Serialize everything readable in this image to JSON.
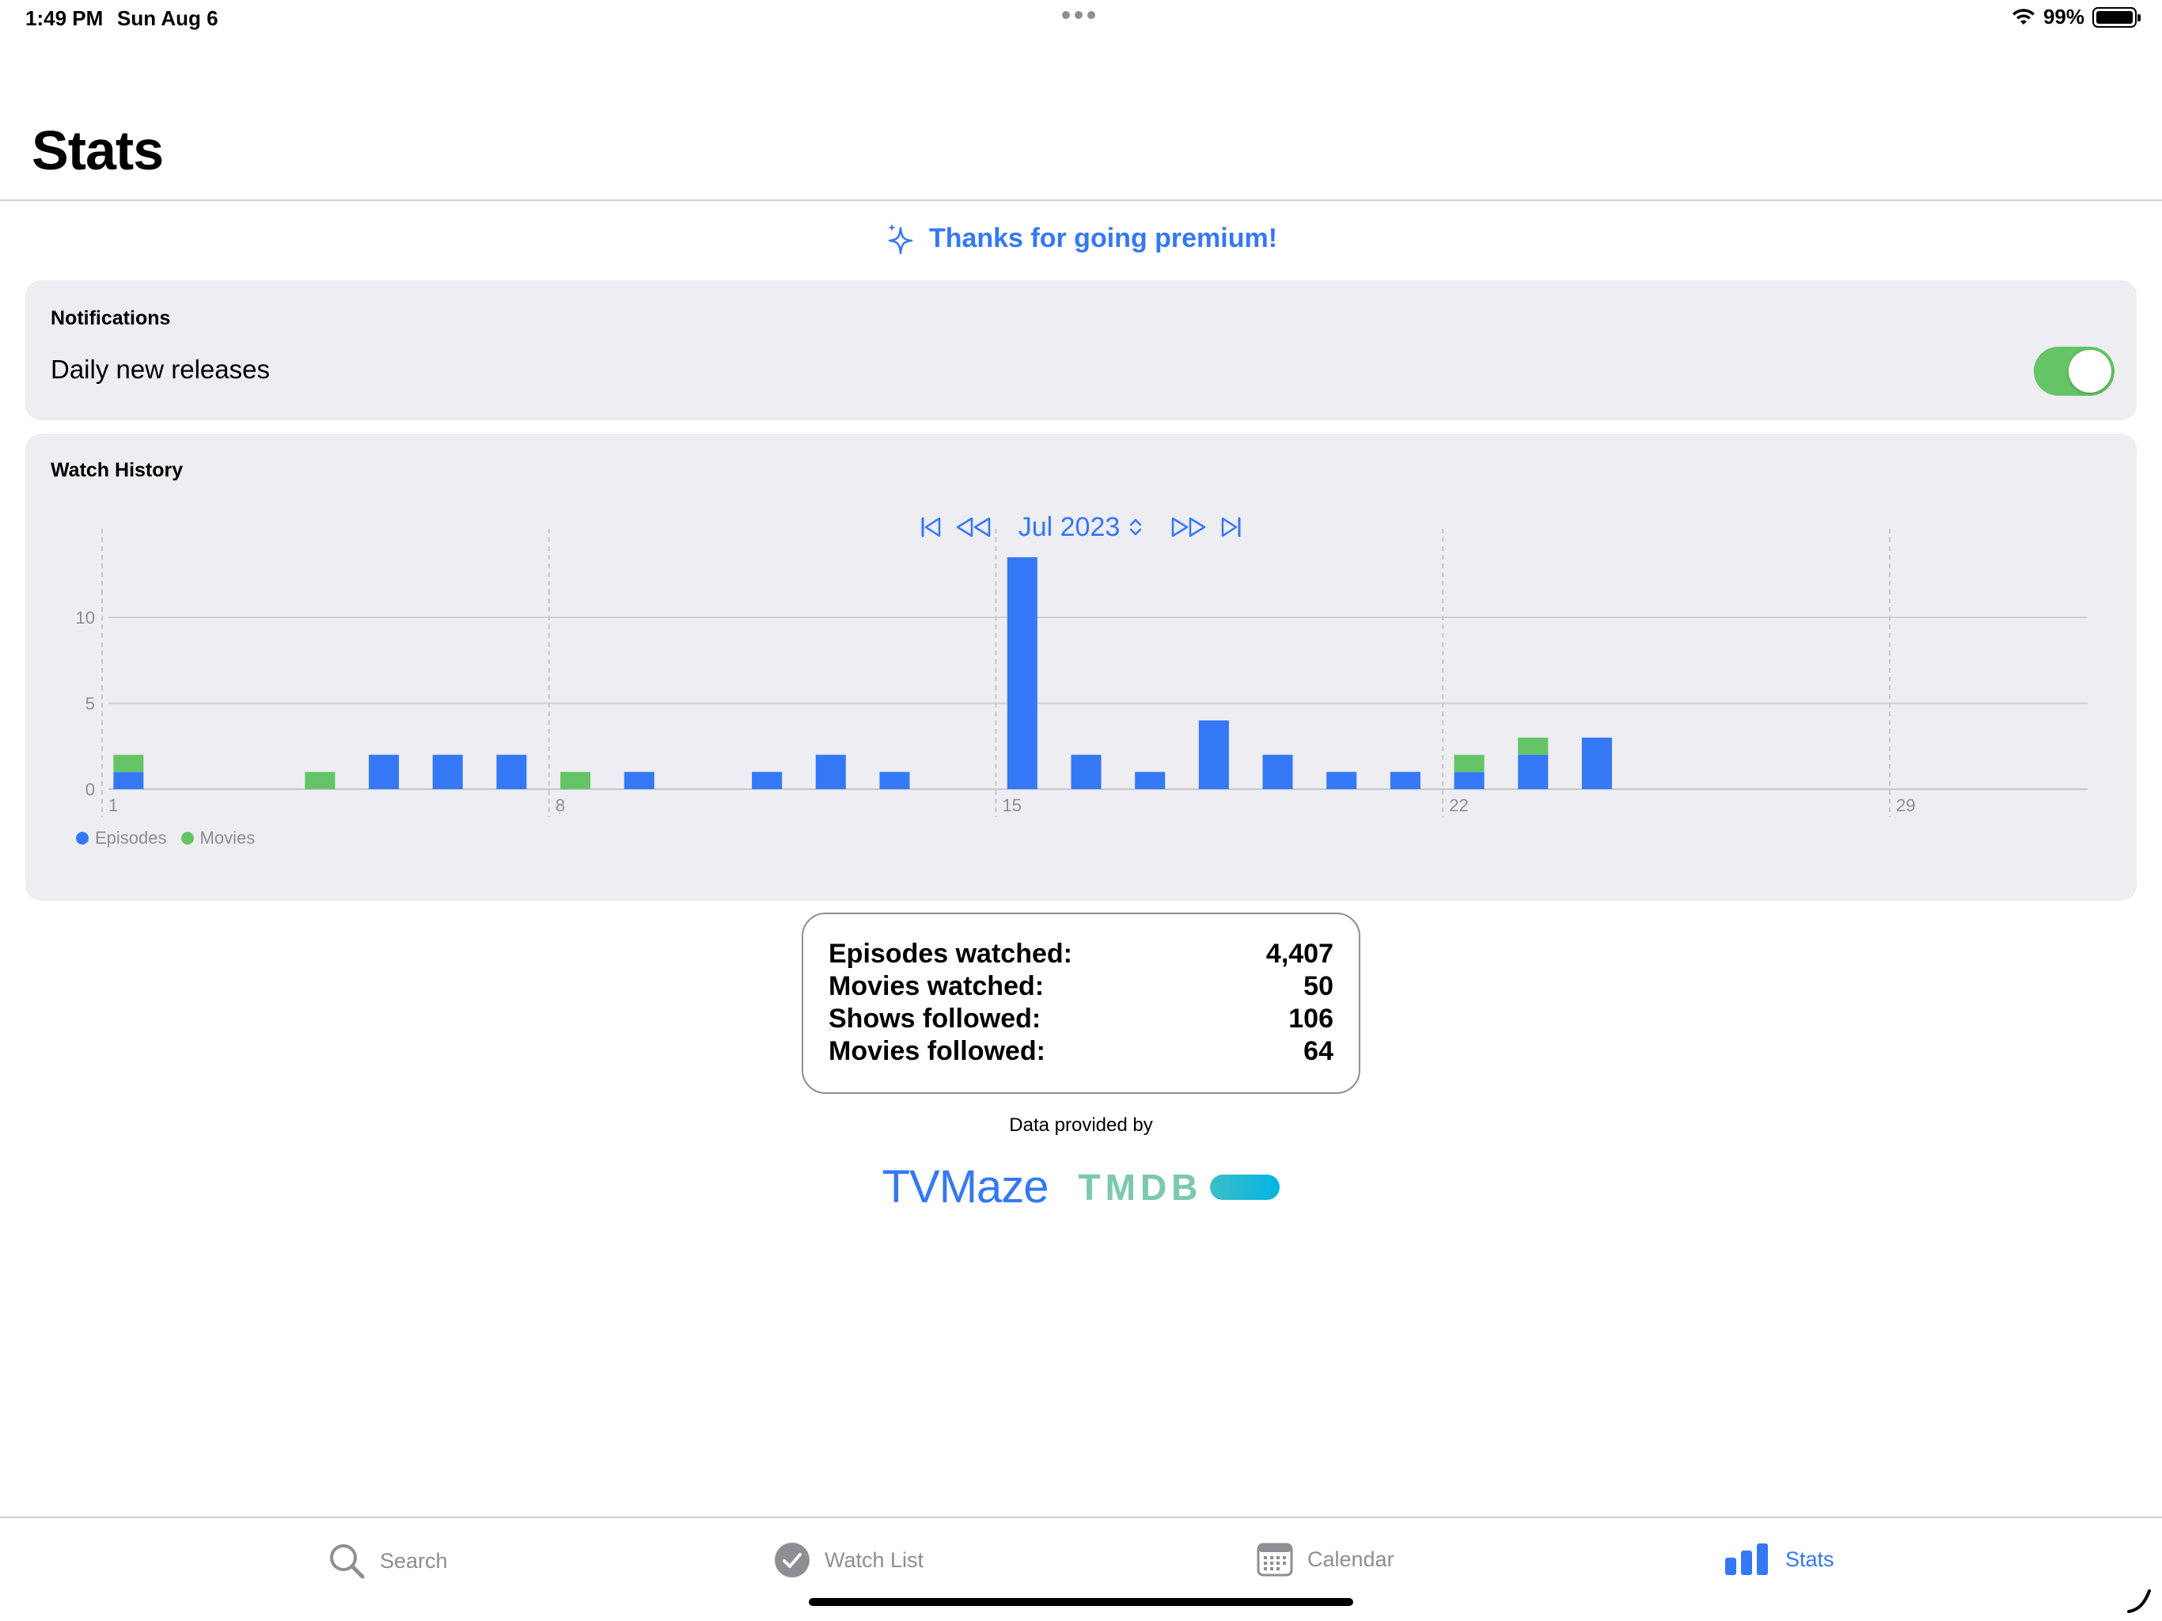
{
  "status_bar": {
    "time": "1:49 PM",
    "date": "Sun Aug 6",
    "battery": "99%",
    "battery_level": 0.99
  },
  "header": {
    "title": "Stats"
  },
  "premium_banner": {
    "text": "Thanks for going premium!"
  },
  "notifications": {
    "title": "Notifications",
    "daily_label": "Daily new releases",
    "daily_enabled": true
  },
  "watch_history": {
    "title": "Watch History",
    "month_label": "Jul 2023"
  },
  "chart_data": {
    "type": "bar",
    "stacked": true,
    "x": [
      1,
      2,
      3,
      4,
      5,
      6,
      7,
      8,
      9,
      10,
      11,
      12,
      13,
      14,
      15,
      16,
      17,
      18,
      19,
      20,
      21,
      22,
      23,
      24,
      25,
      26,
      27,
      28,
      29,
      30,
      31
    ],
    "series": [
      {
        "name": "Episodes",
        "color": "#3478f6",
        "values": [
          1,
          0,
          0,
          0,
          2,
          2,
          2,
          0,
          1,
          0,
          1,
          2,
          1,
          0,
          13.5,
          2,
          1,
          4,
          2,
          1,
          1,
          1,
          2,
          3,
          0,
          0,
          0,
          0,
          0,
          0,
          0
        ]
      },
      {
        "name": "Movies",
        "color": "#65c466",
        "values": [
          1,
          0,
          0,
          1,
          0,
          0,
          0,
          1,
          0,
          0,
          0,
          0,
          0,
          0,
          0,
          0,
          0,
          0,
          0,
          0,
          0,
          1,
          1,
          0,
          0,
          0,
          0,
          0,
          0,
          0,
          0
        ]
      }
    ],
    "x_ticks": [
      "1",
      "8",
      "15",
      "22",
      "29"
    ],
    "y_ticks": [
      "0",
      "5",
      "10"
    ],
    "ylim": [
      0,
      13.5
    ],
    "grid": true,
    "legend_placement": "bottom-left"
  },
  "stats": [
    {
      "label": "Episodes watched:",
      "value": "4,407"
    },
    {
      "label": "Movies watched:",
      "value": "50"
    },
    {
      "label": "Shows followed:",
      "value": "106"
    },
    {
      "label": "Movies followed:",
      "value": "64"
    }
  ],
  "providers": {
    "caption": "Data provided by",
    "tvmaze": "TVMaze",
    "tmdb": "TMDB"
  },
  "tabs": [
    {
      "label": "Search",
      "icon": "search-icon"
    },
    {
      "label": "Watch List",
      "icon": "checkmark-circle-icon"
    },
    {
      "label": "Calendar",
      "icon": "calendar-icon"
    },
    {
      "label": "Stats",
      "icon": "bar-chart-icon",
      "active": true
    }
  ]
}
